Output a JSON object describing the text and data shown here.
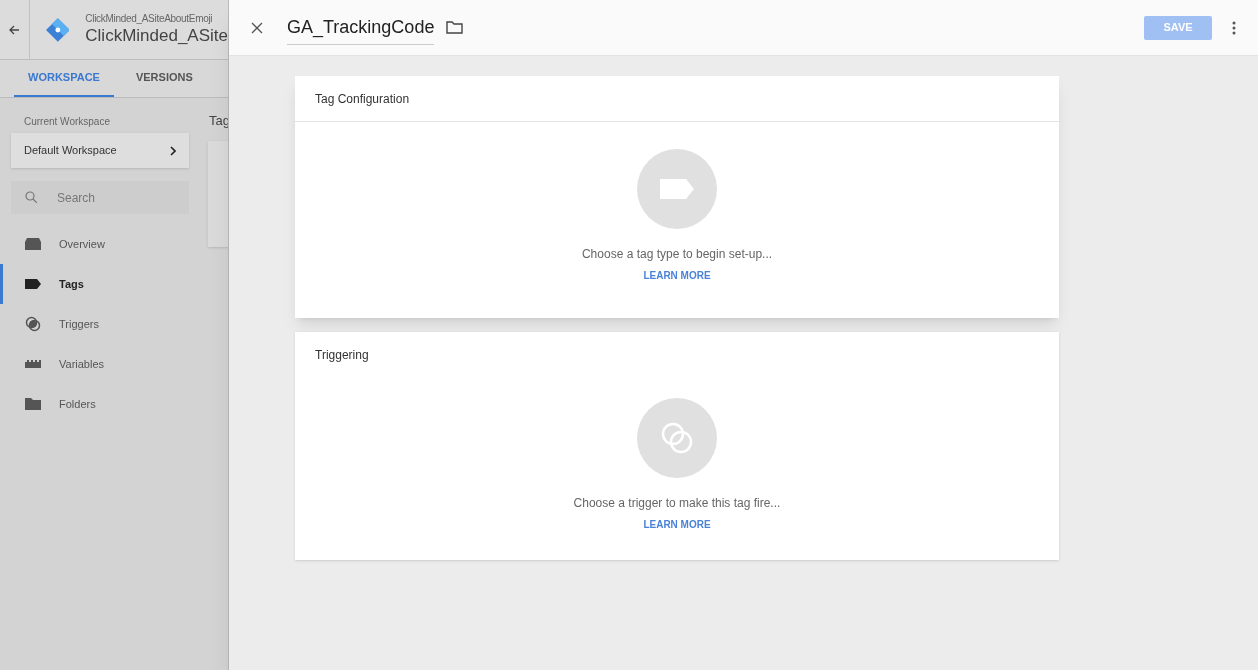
{
  "container": {
    "account": "ClickMinded_ASiteAboutEmoji",
    "name": "ClickMinded_ASite"
  },
  "tabs": [
    {
      "label": "WORKSPACE",
      "selected": true
    },
    {
      "label": "VERSIONS",
      "selected": false
    }
  ],
  "workspace": {
    "label": "Current Workspace",
    "name": "Default Workspace"
  },
  "search": {
    "placeholder": "Search"
  },
  "nav": [
    {
      "kind": "overview",
      "label": "Overview",
      "selected": false
    },
    {
      "kind": "tags",
      "label": "Tags",
      "selected": true
    },
    {
      "kind": "triggers",
      "label": "Triggers",
      "selected": false
    },
    {
      "kind": "variables",
      "label": "Variables",
      "selected": false
    },
    {
      "kind": "folders",
      "label": "Folders",
      "selected": false
    }
  ],
  "main_heading": "Tag",
  "editor": {
    "title": "GA_TrackingCode",
    "save": "SAVE",
    "save_disabled": true
  },
  "cards": [
    {
      "kind": "tag",
      "title": "Tag Configuration",
      "message": "Choose a tag type to begin set-up...",
      "link": "LEARN MORE"
    },
    {
      "kind": "trigger",
      "title": "Triggering",
      "message": "Choose a trigger to make this tag fire...",
      "link": "LEARN MORE"
    }
  ]
}
